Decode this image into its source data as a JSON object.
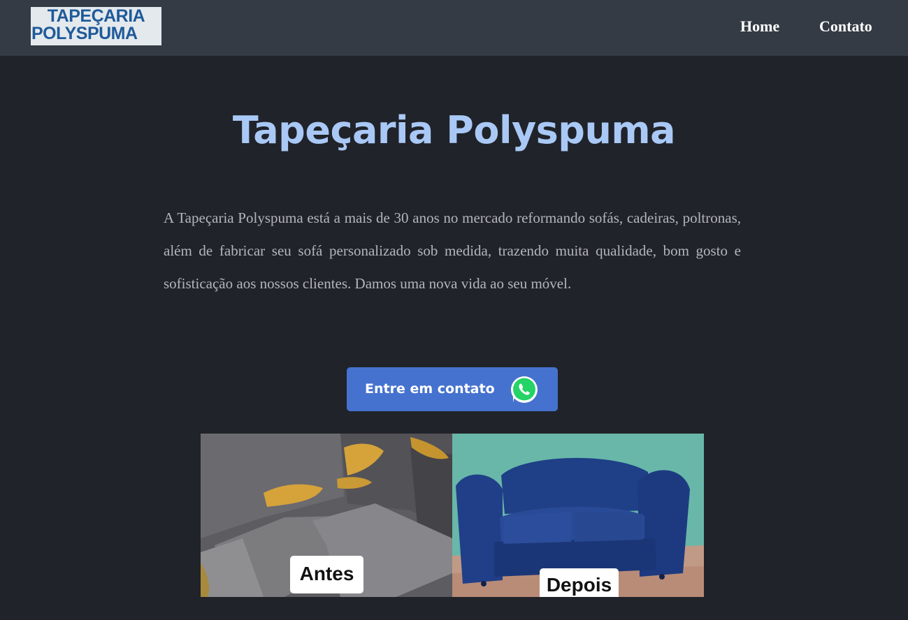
{
  "logo": {
    "line1": "TAPEÇARIA",
    "line2": "POLYSPUMA"
  },
  "nav": {
    "items": [
      {
        "label": "Home"
      },
      {
        "label": "Contato"
      }
    ]
  },
  "hero": {
    "title": "Tapeçaria Polyspuma",
    "description": "A Tapeçaria Polyspuma está a mais de 30 anos no mercado reformando sofás, cadeiras, poltronas, além de fabricar seu sofá personalizado sob medida, trazendo muita qualidade, bom gosto e sofisticação aos nossos clientes. Damos uma nova vida ao seu móvel.",
    "cta_label": "Entre em contato",
    "cta_icon": "whatsapp-icon"
  },
  "gallery": {
    "before_label": "Antes",
    "after_label": "Depois"
  },
  "colors": {
    "background": "#202329",
    "navbar": "#343b44",
    "title": "#a9c8f5",
    "button": "#4672cf",
    "whatsapp": "#25d366"
  }
}
